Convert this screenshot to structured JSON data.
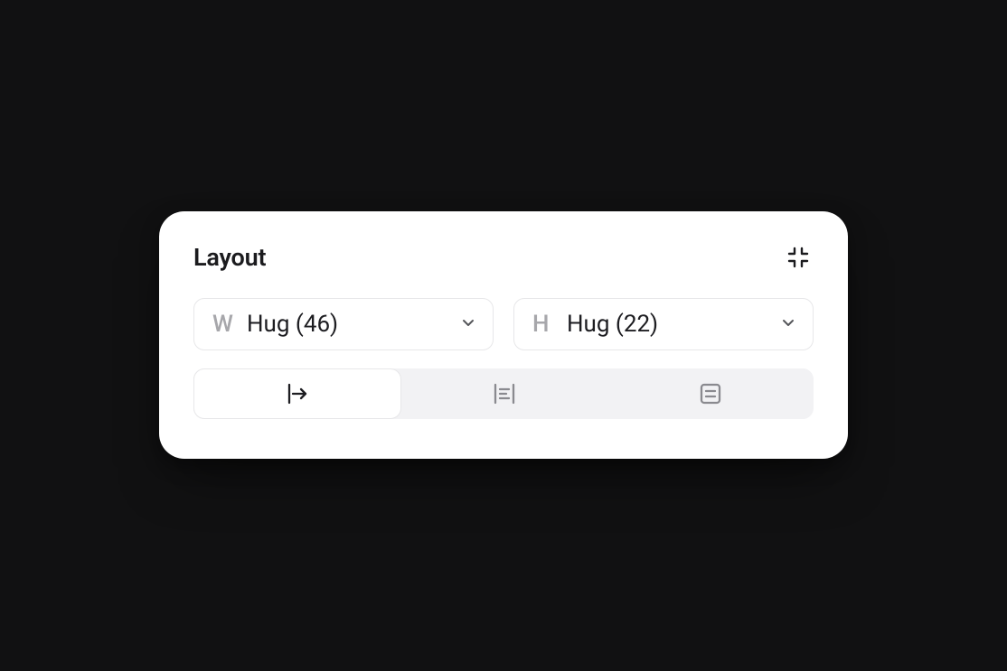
{
  "panel": {
    "title": "Layout",
    "width": {
      "letter": "W",
      "value": "Hug (46)"
    },
    "height": {
      "letter": "H",
      "value": "Hug (22)"
    },
    "modes": {
      "horizontal": "horizontal",
      "vertical": "wrap",
      "grid": "grid",
      "active": "horizontal"
    }
  }
}
